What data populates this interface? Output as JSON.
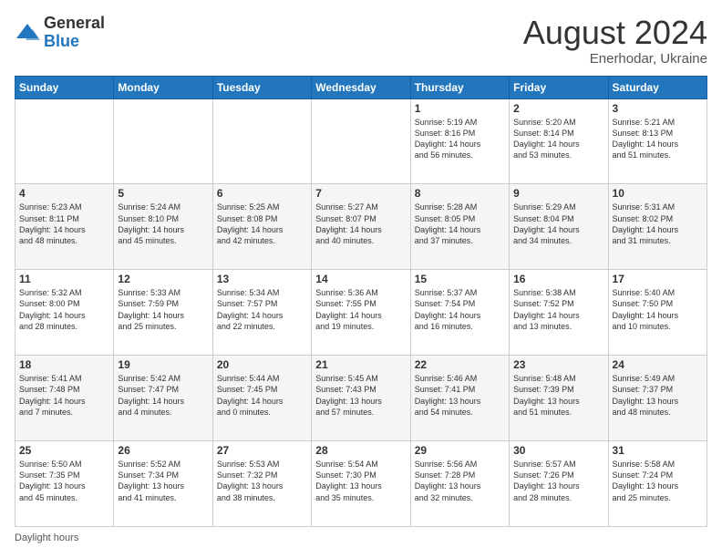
{
  "logo": {
    "general": "General",
    "blue": "Blue"
  },
  "title": {
    "month_year": "August 2024",
    "location": "Enerhodar, Ukraine"
  },
  "footer": {
    "daylight_hours": "Daylight hours"
  },
  "headers": [
    "Sunday",
    "Monday",
    "Tuesday",
    "Wednesday",
    "Thursday",
    "Friday",
    "Saturday"
  ],
  "weeks": [
    [
      {
        "day": "",
        "info": ""
      },
      {
        "day": "",
        "info": ""
      },
      {
        "day": "",
        "info": ""
      },
      {
        "day": "",
        "info": ""
      },
      {
        "day": "1",
        "info": "Sunrise: 5:19 AM\nSunset: 8:16 PM\nDaylight: 14 hours\nand 56 minutes."
      },
      {
        "day": "2",
        "info": "Sunrise: 5:20 AM\nSunset: 8:14 PM\nDaylight: 14 hours\nand 53 minutes."
      },
      {
        "day": "3",
        "info": "Sunrise: 5:21 AM\nSunset: 8:13 PM\nDaylight: 14 hours\nand 51 minutes."
      }
    ],
    [
      {
        "day": "4",
        "info": "Sunrise: 5:23 AM\nSunset: 8:11 PM\nDaylight: 14 hours\nand 48 minutes."
      },
      {
        "day": "5",
        "info": "Sunrise: 5:24 AM\nSunset: 8:10 PM\nDaylight: 14 hours\nand 45 minutes."
      },
      {
        "day": "6",
        "info": "Sunrise: 5:25 AM\nSunset: 8:08 PM\nDaylight: 14 hours\nand 42 minutes."
      },
      {
        "day": "7",
        "info": "Sunrise: 5:27 AM\nSunset: 8:07 PM\nDaylight: 14 hours\nand 40 minutes."
      },
      {
        "day": "8",
        "info": "Sunrise: 5:28 AM\nSunset: 8:05 PM\nDaylight: 14 hours\nand 37 minutes."
      },
      {
        "day": "9",
        "info": "Sunrise: 5:29 AM\nSunset: 8:04 PM\nDaylight: 14 hours\nand 34 minutes."
      },
      {
        "day": "10",
        "info": "Sunrise: 5:31 AM\nSunset: 8:02 PM\nDaylight: 14 hours\nand 31 minutes."
      }
    ],
    [
      {
        "day": "11",
        "info": "Sunrise: 5:32 AM\nSunset: 8:00 PM\nDaylight: 14 hours\nand 28 minutes."
      },
      {
        "day": "12",
        "info": "Sunrise: 5:33 AM\nSunset: 7:59 PM\nDaylight: 14 hours\nand 25 minutes."
      },
      {
        "day": "13",
        "info": "Sunrise: 5:34 AM\nSunset: 7:57 PM\nDaylight: 14 hours\nand 22 minutes."
      },
      {
        "day": "14",
        "info": "Sunrise: 5:36 AM\nSunset: 7:55 PM\nDaylight: 14 hours\nand 19 minutes."
      },
      {
        "day": "15",
        "info": "Sunrise: 5:37 AM\nSunset: 7:54 PM\nDaylight: 14 hours\nand 16 minutes."
      },
      {
        "day": "16",
        "info": "Sunrise: 5:38 AM\nSunset: 7:52 PM\nDaylight: 14 hours\nand 13 minutes."
      },
      {
        "day": "17",
        "info": "Sunrise: 5:40 AM\nSunset: 7:50 PM\nDaylight: 14 hours\nand 10 minutes."
      }
    ],
    [
      {
        "day": "18",
        "info": "Sunrise: 5:41 AM\nSunset: 7:48 PM\nDaylight: 14 hours\nand 7 minutes."
      },
      {
        "day": "19",
        "info": "Sunrise: 5:42 AM\nSunset: 7:47 PM\nDaylight: 14 hours\nand 4 minutes."
      },
      {
        "day": "20",
        "info": "Sunrise: 5:44 AM\nSunset: 7:45 PM\nDaylight: 14 hours\nand 0 minutes."
      },
      {
        "day": "21",
        "info": "Sunrise: 5:45 AM\nSunset: 7:43 PM\nDaylight: 13 hours\nand 57 minutes."
      },
      {
        "day": "22",
        "info": "Sunrise: 5:46 AM\nSunset: 7:41 PM\nDaylight: 13 hours\nand 54 minutes."
      },
      {
        "day": "23",
        "info": "Sunrise: 5:48 AM\nSunset: 7:39 PM\nDaylight: 13 hours\nand 51 minutes."
      },
      {
        "day": "24",
        "info": "Sunrise: 5:49 AM\nSunset: 7:37 PM\nDaylight: 13 hours\nand 48 minutes."
      }
    ],
    [
      {
        "day": "25",
        "info": "Sunrise: 5:50 AM\nSunset: 7:35 PM\nDaylight: 13 hours\nand 45 minutes."
      },
      {
        "day": "26",
        "info": "Sunrise: 5:52 AM\nSunset: 7:34 PM\nDaylight: 13 hours\nand 41 minutes."
      },
      {
        "day": "27",
        "info": "Sunrise: 5:53 AM\nSunset: 7:32 PM\nDaylight: 13 hours\nand 38 minutes."
      },
      {
        "day": "28",
        "info": "Sunrise: 5:54 AM\nSunset: 7:30 PM\nDaylight: 13 hours\nand 35 minutes."
      },
      {
        "day": "29",
        "info": "Sunrise: 5:56 AM\nSunset: 7:28 PM\nDaylight: 13 hours\nand 32 minutes."
      },
      {
        "day": "30",
        "info": "Sunrise: 5:57 AM\nSunset: 7:26 PM\nDaylight: 13 hours\nand 28 minutes."
      },
      {
        "day": "31",
        "info": "Sunrise: 5:58 AM\nSunset: 7:24 PM\nDaylight: 13 hours\nand 25 minutes."
      }
    ]
  ]
}
